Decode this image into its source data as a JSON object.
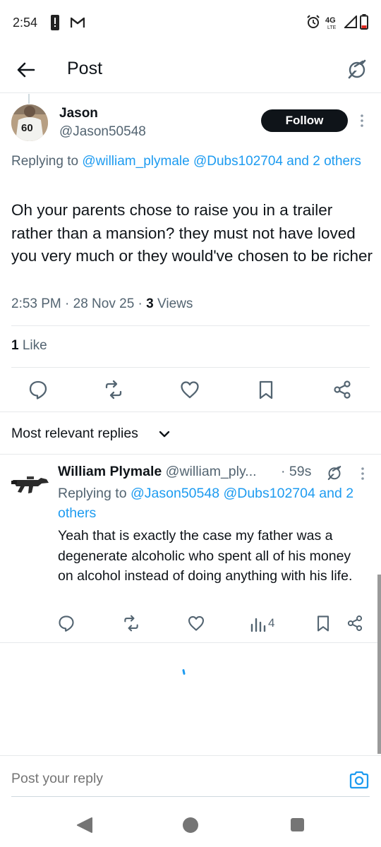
{
  "status_bar": {
    "time": "2:54",
    "icons": [
      "notification-alert-icon",
      "gmail-icon",
      "alarm-icon",
      "4g-lte-icon",
      "signal-icon",
      "battery-icon"
    ]
  },
  "header": {
    "title": "Post",
    "back_icon": "arrow-left-icon",
    "grok_icon": "grok-icon"
  },
  "post": {
    "author_name": "Jason",
    "author_handle": "@Jason50548",
    "follow_label": "Follow",
    "replying_prefix": "Replying to ",
    "replying_link": "@william_plymale @Dubs102704 and 2 others",
    "text": "Oh your parents chose to raise you in a trailer rather than a mansion? they must not have loved you very much or they would've chosen to be richer",
    "timestamp": "2:53 PM · 28 Nov 25 · ",
    "views_count": "3",
    "views_label": " Views",
    "likes_count": "1",
    "likes_label": " Like",
    "avatar_jersey": "60"
  },
  "sort": {
    "label": "Most relevant replies"
  },
  "reply": {
    "name": "William Plymale",
    "handle": "@william_ply...",
    "time": "· 59s",
    "replying_prefix": "Replying to ",
    "replying_link": "@Jason50548 @Dubs102704 and 2 others",
    "text": "Yeah that is exactly the case my father was a degenerate alcoholic who spent all of his money on alcohol instead of doing anything with his life.",
    "views": "4"
  },
  "composer": {
    "placeholder": "Post your reply"
  },
  "colors": {
    "accent": "#1d9bf0",
    "text_primary": "#0f1419",
    "text_secondary": "#536471",
    "follow_bg": "#0f1419"
  }
}
